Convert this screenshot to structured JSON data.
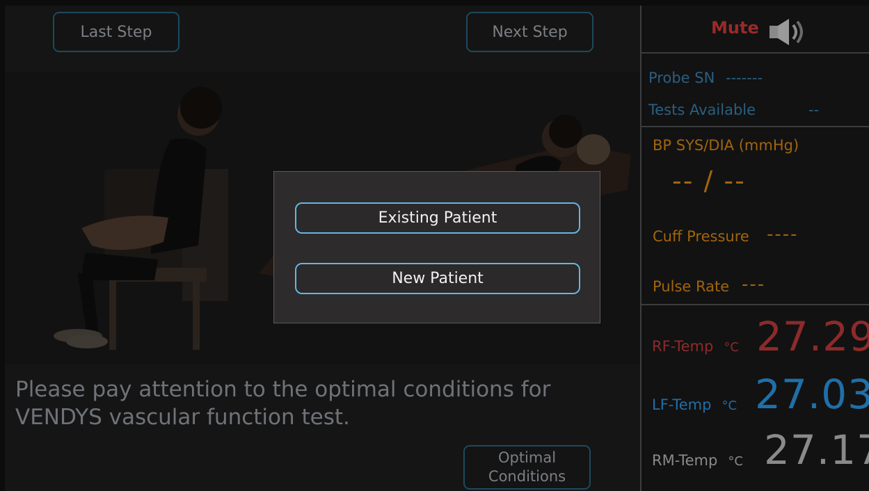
{
  "nav": {
    "last_step": "Last Step",
    "next_step": "Next Step",
    "optimal_conditions": "Optimal\nConditions"
  },
  "instruction": "Please pay attention to the optimal conditions for\nVENDYS vascular function test.",
  "modal": {
    "existing_patient": "Existing Patient",
    "new_patient": "New Patient"
  },
  "panel": {
    "mute_label": "Mute",
    "probe_sn_label": "Probe SN",
    "probe_sn_value": "-------",
    "tests_available_label": "Tests Available",
    "tests_available_value": "--",
    "bp_label": "BP SYS/DIA  (mmHg)",
    "bp_value": "-- / --",
    "cuff_pressure_label": "Cuff Pressure",
    "cuff_pressure_value": "----",
    "pulse_rate_label": "Pulse Rate",
    "pulse_rate_value": "---",
    "temps": [
      {
        "label": "RF-Temp",
        "unit": "°C",
        "value": "27.29",
        "color": "#8e2a2a"
      },
      {
        "label": "LF-Temp",
        "unit": "°C",
        "value": "27.03",
        "color": "#1f6fa8"
      },
      {
        "label": "RM-Temp",
        "unit": "°C",
        "value": "27.17",
        "color": "#8a8a8a"
      }
    ]
  },
  "colors": {
    "blue_label": "#2a5f80",
    "orange_label": "#a0650e",
    "modal_border": "#64b7e2"
  }
}
